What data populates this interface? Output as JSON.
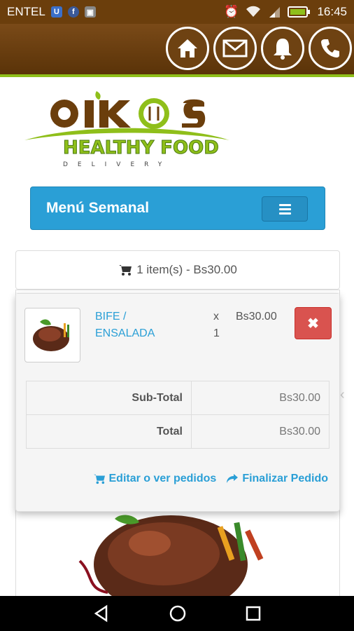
{
  "status_bar": {
    "carrier": "ENTEL",
    "time": "16:45"
  },
  "header": {
    "buttons": [
      {
        "icon": "home-icon"
      },
      {
        "icon": "mail-icon"
      },
      {
        "icon": "bell-icon"
      },
      {
        "icon": "phone-icon"
      }
    ]
  },
  "logo": {
    "brand": "OIKOS",
    "tagline": "HEALTHY FOOD",
    "sub": "DELIVERY"
  },
  "menu": {
    "title": "Menú Semanal"
  },
  "cart": {
    "summary": "1 item(s) - Bs30.00",
    "item": {
      "name_line1": "BIFE /",
      "name_line2": "ENSALADA",
      "qty_x": "x",
      "qty": "1",
      "price": "Bs30.00"
    },
    "subtotal_label": "Sub-Total",
    "subtotal_value": "Bs30.00",
    "total_label": "Total",
    "total_value": "Bs30.00",
    "edit_label": "Editar o ver pedidos",
    "checkout_label": "Finalizar Pedido"
  },
  "colors": {
    "header_brown": "#6b3e0c",
    "accent_blue": "#2a9fd6",
    "accent_green": "#8fbf1a",
    "danger_red": "#d9534f"
  }
}
